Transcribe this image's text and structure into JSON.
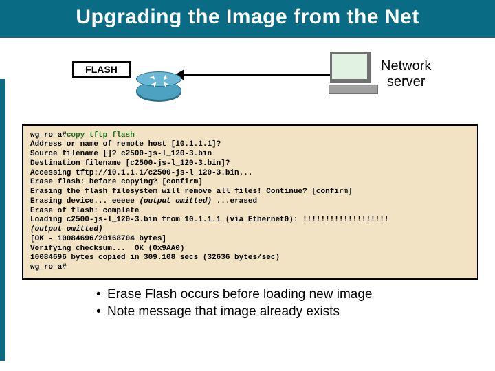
{
  "title": "Upgrading the Image from the Net",
  "diagram": {
    "flash_label": "FLASH",
    "network_label": "Network\nserver"
  },
  "terminal": {
    "prompt1_prefix": "wg_ro_a#",
    "prompt1_cmd": "copy tftp flash",
    "line2": "Address or name of remote host [10.1.1.1]?",
    "line3": "Source filename []? c2500-js-l_120-3.bin",
    "line4": "Destination filename [c2500-js-l_120-3.bin]?",
    "line5": "Accessing tftp://10.1.1.1/c2500-js-l_120-3.bin...",
    "line6": "Erase flash: before copying? [confirm]",
    "line7": "Erasing the flash filesystem will remove all files! Continue? [confirm]",
    "line8a": "Erasing device... eeeee ",
    "line8b_ital": "(output omitted)",
    "line8c": " ...erased",
    "line9": "Erase of flash: complete",
    "line10": "Loading c2500-js-l_120-3.bin from 10.1.1.1 (via Ethernet0): !!!!!!!!!!!!!!!!!!!",
    "line11_ital": "(output omitted)",
    "line12": "[OK - 10084696/20168704 bytes]",
    "line13": "Verifying checksum...  OK (0x9AA0)",
    "line14": "10084696 bytes copied in 309.108 secs (32636 bytes/sec)",
    "line15": "wg_ro_a#"
  },
  "notes": {
    "b1": "Erase Flash occurs before loading new image",
    "b2": "Note message that image already exists"
  }
}
